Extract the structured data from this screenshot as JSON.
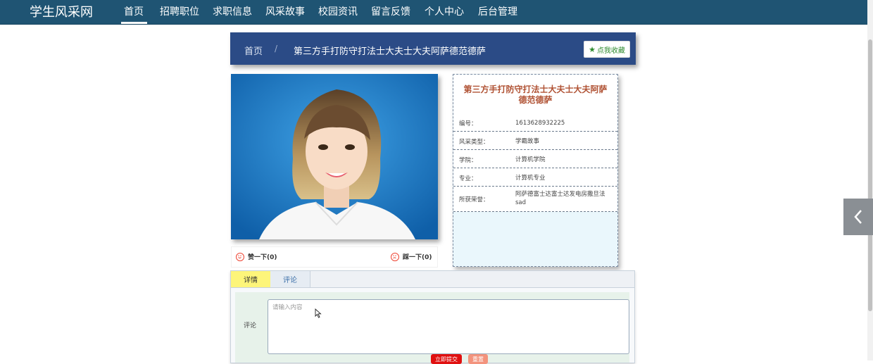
{
  "brand": "学生风采网",
  "nav": {
    "items": [
      "首页",
      "招聘职位",
      "求职信息",
      "风采故事",
      "校园资讯",
      "留言反馈",
      "个人中心",
      "后台管理"
    ]
  },
  "breadcrumb": {
    "home": "首页",
    "sep": "/",
    "current": "第三方手打防守打法士大夫士大夫阿萨德范德萨"
  },
  "favorite": {
    "star": "★",
    "label": "点我收藏"
  },
  "detail": {
    "title": "第三方手打防守打法士大夫士大夫阿萨德范德萨",
    "fields": [
      {
        "key": "编号：",
        "value": "1613628932225"
      },
      {
        "key": "风采类型：",
        "value": "学霸故事"
      },
      {
        "key": "学院：",
        "value": "计算机学院"
      },
      {
        "key": "专业：",
        "value": "计算机专业"
      },
      {
        "key": "所获荣誉：",
        "value": "阿萨德富士达富士达发电房撒旦法sad"
      }
    ]
  },
  "votes": {
    "like": "赞一下(0)",
    "dislike": "踩一下(0)"
  },
  "tabs": [
    "详情",
    "评论"
  ],
  "comment": {
    "label": "评论",
    "placeholder": "请输入内容",
    "submit": "立即提交",
    "reset": "重置"
  },
  "colors": {
    "nav_bg": "#1f5473",
    "crumb_bg": "#2b4b86",
    "title_color": "#b05234",
    "active_tab": "#fdf57a",
    "submit": "#e01010"
  },
  "icons": {
    "favorite": "star-icon",
    "vote_like": "smile-face-icon",
    "vote_dislike": "frown-face-icon",
    "side": "chevron-left-icon",
    "pointer": "mouse-cursor-icon"
  }
}
